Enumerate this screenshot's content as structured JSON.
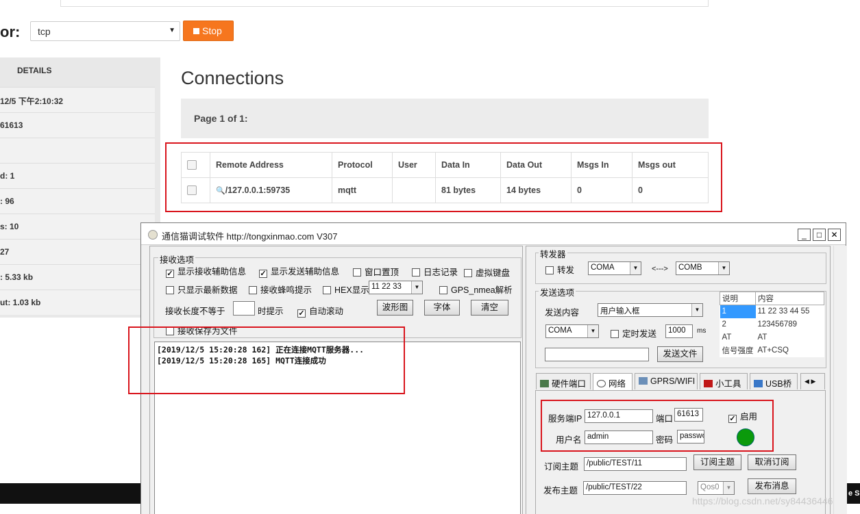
{
  "dashboard": {
    "monitor_label": "or:",
    "protocol_value": "tcp",
    "stop_label": "Stop",
    "sidebar_header": "DETAILS",
    "sidebar_rows": [
      "12/5 下午2:10:32",
      "61613",
      "",
      "d: 1",
      ": 96",
      "s: 10",
      "27",
      ": 5.33 kb",
      "ut: 1.03 kb"
    ],
    "connections_title": "Connections",
    "page_info": "Page 1 of 1:",
    "table": {
      "headers": [
        "Remote Address",
        "Protocol",
        "User",
        "Data In",
        "Data Out",
        "Msgs In",
        "Msgs out"
      ],
      "rows": [
        {
          "remote": "/127.0.0.1:59735",
          "protocol": "mqtt",
          "user": "",
          "data_in": "81 bytes",
          "data_out": "14 bytes",
          "msgs_in": "0",
          "msgs_out": "0"
        }
      ]
    }
  },
  "app": {
    "title": "通信猫调试软件  http://tongxinmao.com  V307",
    "recv_group": "接收选项",
    "recv_options": [
      {
        "label": "显示接收辅助信息",
        "checked": true
      },
      {
        "label": "显示发送辅助信息",
        "checked": true
      },
      {
        "label": "窗口置顶",
        "checked": false
      },
      {
        "label": "日志记录",
        "checked": false
      },
      {
        "label": "虚拟键盘",
        "checked": false
      },
      {
        "label": "只显示最新数据",
        "checked": false
      },
      {
        "label": "接收蜂鸣提示",
        "checked": false
      },
      {
        "label": "HEX显示",
        "checked": false
      },
      {
        "label": "GPS_nmea解析",
        "checked": false
      },
      {
        "label": "自动滚动",
        "checked": true
      },
      {
        "label": "接收保存为文件",
        "checked": false
      }
    ],
    "hex_value": "11 22 33",
    "recv_len_label": "接收长度不等于",
    "recv_len_value": "",
    "recv_len_suffix": "时提示",
    "btn_wave": "波形图",
    "btn_font": "字体",
    "btn_clear": "清空",
    "log_lines": [
      "[2019/12/5 15:20:28 162]  正在连接MQTT服务器...",
      "[2019/12/5 15:20:28 165]  MQTT连接成功"
    ],
    "forward_group": "转发器",
    "forward_label": "转发",
    "forward_a": "COMA",
    "forward_arrow": "<--->",
    "forward_b": "COMB",
    "send_group": "发送选项",
    "send_content_label": "发送内容",
    "send_content_value": "用户输入框",
    "send_port": "COMA",
    "timed_send_label": "定时发送",
    "timed_value": "1000",
    "timed_unit": "ms",
    "send_file_btn": "发送文件",
    "list_headers": [
      "说明",
      "内容"
    ],
    "list_rows": [
      [
        "1",
        "11 22 33 44 55"
      ],
      [
        "2",
        "123456789"
      ],
      [
        "AT",
        "AT"
      ],
      [
        "信号强度",
        "AT+CSQ"
      ]
    ],
    "tabs": [
      "硬件端口",
      "网络",
      "GPRS/WIFI",
      "小工具",
      "USB桥"
    ],
    "server_ip_label": "服务端IP",
    "server_ip": "127.0.0.1",
    "port_label": "端口",
    "port": "61613",
    "enable_label": "启用",
    "user_label": "用户名",
    "user": "admin",
    "pass_label": "密码",
    "pass": "passwo",
    "sub_label": "订阅主题",
    "sub_topic": "/public/TEST/11",
    "sub_btn": "订阅主题",
    "unsub_btn": "取消订阅",
    "pub_label": "发布主题",
    "pub_topic": "/public/TEST/22",
    "qos": "Qos0",
    "pub_btn": "发布消息"
  },
  "watermark": "https://blog.csdn.net/sy84436446",
  "edge_text": "e S"
}
